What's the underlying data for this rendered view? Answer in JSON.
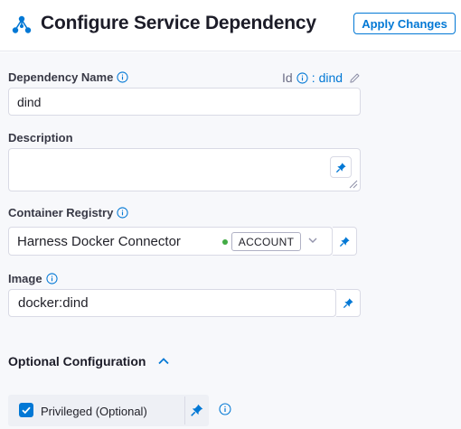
{
  "header": {
    "title": "Configure Service Dependency",
    "apply_label": "Apply Changes"
  },
  "colors": {
    "accent": "#0278d5",
    "status_ok": "#42ab45",
    "background": "#f7f8fb"
  },
  "icons": {
    "header": "service-dependency-icon",
    "info": "info-circle-icon",
    "pin": "pin-icon",
    "edit": "pencil-icon",
    "caret_down": "chevron-down-icon",
    "caret_up": "chevron-up-icon",
    "check": "check-icon"
  },
  "form": {
    "dependency_name": {
      "label": "Dependency Name",
      "value": "dind",
      "id_label": "Id",
      "id_separator": ":",
      "id_value": "dind"
    },
    "description": {
      "label": "Description",
      "value": ""
    },
    "container_registry": {
      "label": "Container Registry",
      "value": "Harness Docker Connector",
      "scope_badge": "ACCOUNT"
    },
    "image": {
      "label": "Image",
      "value": "docker:dind"
    },
    "optional": {
      "section_title": "Optional Configuration",
      "expanded": true,
      "privileged": {
        "label": "Privileged (Optional)",
        "checked": true
      }
    }
  }
}
